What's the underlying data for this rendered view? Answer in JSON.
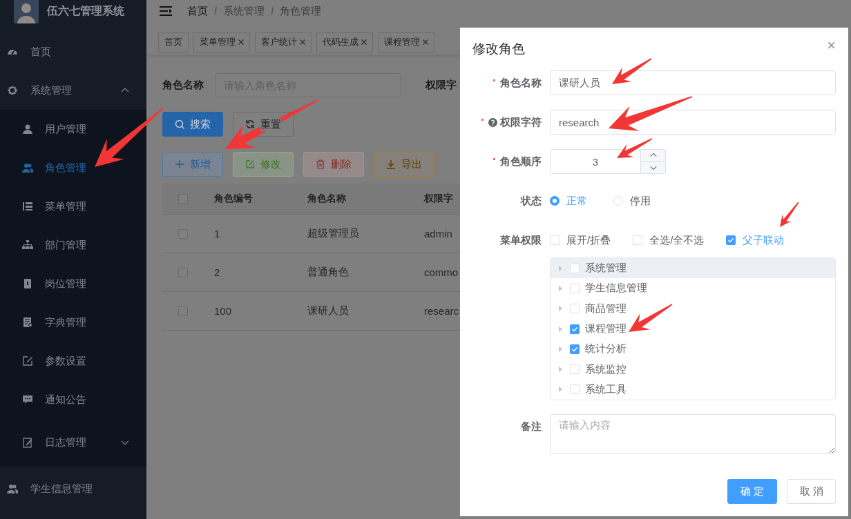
{
  "sidebar": {
    "title": "伍六七管理系统",
    "items": [
      {
        "label": "首页",
        "selected": false
      },
      {
        "label": "系统管理",
        "selected": false,
        "expanded": true,
        "children": [
          {
            "label": "用户管理",
            "selected": false
          },
          {
            "label": "角色管理",
            "selected": true
          },
          {
            "label": "菜单管理",
            "selected": false
          },
          {
            "label": "部门管理",
            "selected": false
          },
          {
            "label": "岗位管理",
            "selected": false
          },
          {
            "label": "字典管理",
            "selected": false
          },
          {
            "label": "参数设置",
            "selected": false
          },
          {
            "label": "通知公告",
            "selected": false
          },
          {
            "label": "日志管理",
            "selected": false,
            "expanded": false
          }
        ]
      },
      {
        "label": "学生信息管理",
        "selected": false
      }
    ]
  },
  "breadcrumb": {
    "separator": "/",
    "items": [
      "首页",
      "系统管理",
      "角色管理"
    ]
  },
  "tags": [
    {
      "label": "首页",
      "closable": false
    },
    {
      "label": "菜单管理",
      "closable": true
    },
    {
      "label": "客户统计",
      "closable": true
    },
    {
      "label": "代码生成",
      "closable": true
    },
    {
      "label": "课程管理",
      "closable": true
    }
  ],
  "search_form": {
    "fields": [
      {
        "label": "角色名称",
        "placeholder": "请输入角色名称"
      },
      {
        "label": "权限字"
      }
    ],
    "buttons": [
      {
        "label": "搜索",
        "kind": "primary"
      },
      {
        "label": "重置",
        "kind": "default"
      }
    ]
  },
  "toolbar": [
    {
      "label": "新增",
      "kind": "primary",
      "disabled": false
    },
    {
      "label": "修改",
      "kind": "success",
      "disabled": true
    },
    {
      "label": "删除",
      "kind": "danger",
      "disabled": true
    },
    {
      "label": "导出",
      "kind": "warning",
      "disabled": false
    }
  ],
  "table": {
    "all_selected": false,
    "columns": [
      "角色编号",
      "角色名称",
      "权限字"
    ],
    "rows": [
      {
        "selected": false,
        "cells": [
          "1",
          "超级管理员",
          "admin"
        ]
      },
      {
        "selected": false,
        "cells": [
          "2",
          "普通角色",
          "commo"
        ]
      },
      {
        "selected": false,
        "cells": [
          "100",
          "课研人员",
          "researc"
        ]
      }
    ]
  },
  "dialog": {
    "title": "修改角色",
    "close": "×",
    "fields": [
      {
        "kind": "text",
        "label": "角色名称",
        "required": true,
        "help": false,
        "value": "课研人员"
      },
      {
        "kind": "text",
        "label": "权限字符",
        "required": true,
        "help": true,
        "value": "research"
      },
      {
        "kind": "number",
        "label": "角色顺序",
        "required": true,
        "help": false,
        "value": "3"
      },
      {
        "kind": "radio",
        "label": "状态",
        "required": false,
        "help": false,
        "options": [
          {
            "label": "正常",
            "selected": true
          },
          {
            "label": "停用",
            "selected": false
          }
        ]
      },
      {
        "kind": "tree",
        "label": "菜单权限",
        "required": false,
        "help": false,
        "options": [
          {
            "label": "展开/折叠",
            "checked": false
          },
          {
            "label": "全选/全不选",
            "checked": false
          },
          {
            "label": "父子联动",
            "checked": true
          }
        ],
        "nodes": [
          {
            "label": "系统管理",
            "checked": false,
            "expanded": false,
            "highlighted": true
          },
          {
            "label": "学生信息管理",
            "checked": false,
            "expanded": false,
            "highlighted": false
          },
          {
            "label": "商品管理",
            "checked": false,
            "expanded": false,
            "highlighted": false
          },
          {
            "label": "课程管理",
            "checked": true,
            "expanded": false,
            "highlighted": false
          },
          {
            "label": "统计分析",
            "checked": true,
            "expanded": false,
            "highlighted": false
          },
          {
            "label": "系统监控",
            "checked": false,
            "expanded": false,
            "highlighted": false
          },
          {
            "label": "系统工具",
            "checked": false,
            "expanded": false,
            "highlighted": false
          }
        ]
      },
      {
        "kind": "textarea",
        "label": "备注",
        "required": false,
        "help": false,
        "placeholder": "请输入内容"
      }
    ],
    "buttons": [
      {
        "label": "确定",
        "kind": "primary"
      },
      {
        "label": "取消",
        "kind": "default"
      }
    ]
  },
  "annotations": [
    {
      "kind": "arrow"
    },
    {
      "kind": "arrow"
    },
    {
      "kind": "arrow"
    },
    {
      "kind": "arrow"
    },
    {
      "kind": "arrow"
    },
    {
      "kind": "arrow"
    },
    {
      "kind": "arrow"
    }
  ]
}
